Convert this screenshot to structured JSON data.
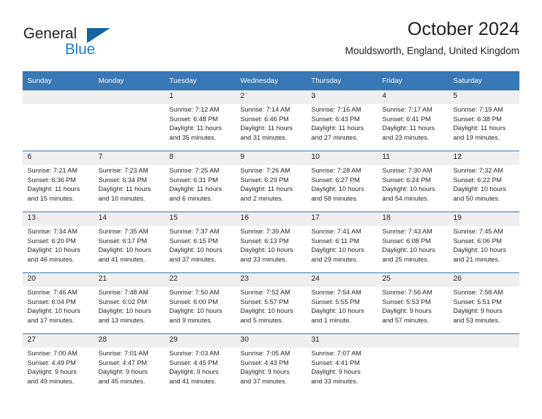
{
  "logo": {
    "word1": "General",
    "word2": "Blue",
    "triangle_color": "#1464a0",
    "word2_color": "#1b7fd4"
  },
  "header": {
    "title": "October 2024",
    "location": "Mouldsworth, England, United Kingdom"
  },
  "theme": {
    "header_bg": "#3878b4",
    "row_divider": "#2e6da4",
    "daynum_bg": "#efefef",
    "text": "#231f20"
  },
  "calendar": {
    "weekdays": [
      "Sunday",
      "Monday",
      "Tuesday",
      "Wednesday",
      "Thursday",
      "Friday",
      "Saturday"
    ],
    "labels": {
      "sunrise": "Sunrise:",
      "sunset": "Sunset:",
      "daylight": "Daylight:"
    },
    "weeks": [
      [
        {
          "day": "",
          "lines": []
        },
        {
          "day": "",
          "lines": []
        },
        {
          "day": "1",
          "lines": [
            "Sunrise: 7:12 AM",
            "Sunset: 6:48 PM",
            "Daylight: 11 hours",
            "and 35 minutes."
          ]
        },
        {
          "day": "2",
          "lines": [
            "Sunrise: 7:14 AM",
            "Sunset: 6:46 PM",
            "Daylight: 11 hours",
            "and 31 minutes."
          ]
        },
        {
          "day": "3",
          "lines": [
            "Sunrise: 7:16 AM",
            "Sunset: 6:43 PM",
            "Daylight: 11 hours",
            "and 27 minutes."
          ]
        },
        {
          "day": "4",
          "lines": [
            "Sunrise: 7:17 AM",
            "Sunset: 6:41 PM",
            "Daylight: 11 hours",
            "and 23 minutes."
          ]
        },
        {
          "day": "5",
          "lines": [
            "Sunrise: 7:19 AM",
            "Sunset: 6:38 PM",
            "Daylight: 11 hours",
            "and 19 minutes."
          ]
        }
      ],
      [
        {
          "day": "6",
          "lines": [
            "Sunrise: 7:21 AM",
            "Sunset: 6:36 PM",
            "Daylight: 11 hours",
            "and 15 minutes."
          ]
        },
        {
          "day": "7",
          "lines": [
            "Sunrise: 7:23 AM",
            "Sunset: 6:34 PM",
            "Daylight: 11 hours",
            "and 10 minutes."
          ]
        },
        {
          "day": "8",
          "lines": [
            "Sunrise: 7:25 AM",
            "Sunset: 6:31 PM",
            "Daylight: 11 hours",
            "and 6 minutes."
          ]
        },
        {
          "day": "9",
          "lines": [
            "Sunrise: 7:26 AM",
            "Sunset: 6:29 PM",
            "Daylight: 11 hours",
            "and 2 minutes."
          ]
        },
        {
          "day": "10",
          "lines": [
            "Sunrise: 7:28 AM",
            "Sunset: 6:27 PM",
            "Daylight: 10 hours",
            "and 58 minutes."
          ]
        },
        {
          "day": "11",
          "lines": [
            "Sunrise: 7:30 AM",
            "Sunset: 6:24 PM",
            "Daylight: 10 hours",
            "and 54 minutes."
          ]
        },
        {
          "day": "12",
          "lines": [
            "Sunrise: 7:32 AM",
            "Sunset: 6:22 PM",
            "Daylight: 10 hours",
            "and 50 minutes."
          ]
        }
      ],
      [
        {
          "day": "13",
          "lines": [
            "Sunrise: 7:34 AM",
            "Sunset: 6:20 PM",
            "Daylight: 10 hours",
            "and 46 minutes."
          ]
        },
        {
          "day": "14",
          "lines": [
            "Sunrise: 7:35 AM",
            "Sunset: 6:17 PM",
            "Daylight: 10 hours",
            "and 41 minutes."
          ]
        },
        {
          "day": "15",
          "lines": [
            "Sunrise: 7:37 AM",
            "Sunset: 6:15 PM",
            "Daylight: 10 hours",
            "and 37 minutes."
          ]
        },
        {
          "day": "16",
          "lines": [
            "Sunrise: 7:39 AM",
            "Sunset: 6:13 PM",
            "Daylight: 10 hours",
            "and 33 minutes."
          ]
        },
        {
          "day": "17",
          "lines": [
            "Sunrise: 7:41 AM",
            "Sunset: 6:11 PM",
            "Daylight: 10 hours",
            "and 29 minutes."
          ]
        },
        {
          "day": "18",
          "lines": [
            "Sunrise: 7:43 AM",
            "Sunset: 6:08 PM",
            "Daylight: 10 hours",
            "and 25 minutes."
          ]
        },
        {
          "day": "19",
          "lines": [
            "Sunrise: 7:45 AM",
            "Sunset: 6:06 PM",
            "Daylight: 10 hours",
            "and 21 minutes."
          ]
        }
      ],
      [
        {
          "day": "20",
          "lines": [
            "Sunrise: 7:46 AM",
            "Sunset: 6:04 PM",
            "Daylight: 10 hours",
            "and 17 minutes."
          ]
        },
        {
          "day": "21",
          "lines": [
            "Sunrise: 7:48 AM",
            "Sunset: 6:02 PM",
            "Daylight: 10 hours",
            "and 13 minutes."
          ]
        },
        {
          "day": "22",
          "lines": [
            "Sunrise: 7:50 AM",
            "Sunset: 6:00 PM",
            "Daylight: 10 hours",
            "and 9 minutes."
          ]
        },
        {
          "day": "23",
          "lines": [
            "Sunrise: 7:52 AM",
            "Sunset: 5:57 PM",
            "Daylight: 10 hours",
            "and 5 minutes."
          ]
        },
        {
          "day": "24",
          "lines": [
            "Sunrise: 7:54 AM",
            "Sunset: 5:55 PM",
            "Daylight: 10 hours",
            "and 1 minute."
          ]
        },
        {
          "day": "25",
          "lines": [
            "Sunrise: 7:56 AM",
            "Sunset: 5:53 PM",
            "Daylight: 9 hours",
            "and 57 minutes."
          ]
        },
        {
          "day": "26",
          "lines": [
            "Sunrise: 7:58 AM",
            "Sunset: 5:51 PM",
            "Daylight: 9 hours",
            "and 53 minutes."
          ]
        }
      ],
      [
        {
          "day": "27",
          "lines": [
            "Sunrise: 7:00 AM",
            "Sunset: 4:49 PM",
            "Daylight: 9 hours",
            "and 49 minutes."
          ]
        },
        {
          "day": "28",
          "lines": [
            "Sunrise: 7:01 AM",
            "Sunset: 4:47 PM",
            "Daylight: 9 hours",
            "and 45 minutes."
          ]
        },
        {
          "day": "29",
          "lines": [
            "Sunrise: 7:03 AM",
            "Sunset: 4:45 PM",
            "Daylight: 9 hours",
            "and 41 minutes."
          ]
        },
        {
          "day": "30",
          "lines": [
            "Sunrise: 7:05 AM",
            "Sunset: 4:43 PM",
            "Daylight: 9 hours",
            "and 37 minutes."
          ]
        },
        {
          "day": "31",
          "lines": [
            "Sunrise: 7:07 AM",
            "Sunset: 4:41 PM",
            "Daylight: 9 hours",
            "and 33 minutes."
          ]
        },
        {
          "day": "",
          "lines": []
        },
        {
          "day": "",
          "lines": []
        }
      ]
    ]
  }
}
